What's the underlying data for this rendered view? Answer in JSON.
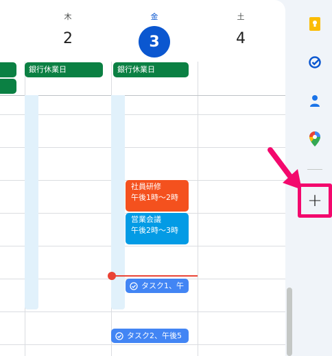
{
  "days": [
    {
      "dow": "木",
      "date": "2"
    },
    {
      "dow": "金",
      "date": "3",
      "today": true
    },
    {
      "dow": "土",
      "date": "4"
    }
  ],
  "all_day_events": [
    {
      "title": "銀行休業日",
      "color": "#0b8043"
    },
    {
      "title": "銀行休業日",
      "color": "#0b8043"
    }
  ],
  "events": [
    {
      "title": "社員研修",
      "time": "午後1時～2時",
      "color": "#f4511e"
    },
    {
      "title": "営業会議",
      "time": "午後2時～3時",
      "color": "#039be5"
    }
  ],
  "tasks": [
    {
      "title": "タスク1、午"
    },
    {
      "title": "タスク2、午後5"
    }
  ],
  "side_panel": {
    "icons": [
      "keep-icon",
      "tasks-icon",
      "contacts-icon",
      "maps-icon"
    ],
    "add_label": "+"
  },
  "colors": {
    "today": "#0b57d0",
    "bank_holiday": "#0b8043",
    "training": "#f4511e",
    "meeting": "#039be5",
    "task": "#4285f4",
    "now_line": "#ea4335",
    "annotation": "#f3086d"
  }
}
